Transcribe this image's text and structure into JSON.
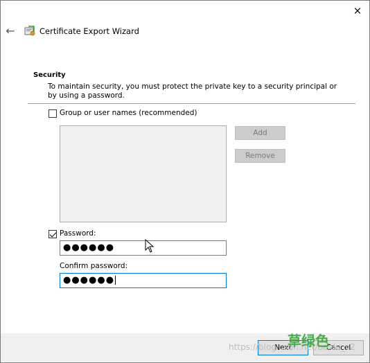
{
  "window": {
    "close_glyph": "✕",
    "back_glyph": "←",
    "title": "Certificate Export Wizard"
  },
  "security": {
    "title": "Security",
    "description": "To maintain security, you must protect the private key to a security principal or by using a password."
  },
  "group_option": {
    "label": "Group or user names (recommended)",
    "checked": false
  },
  "buttons": {
    "add": "Add",
    "remove": "Remove",
    "next": "Next",
    "cancel": "Cancel"
  },
  "password_option": {
    "label": "Password:",
    "checked": true,
    "value_masked": "●●●●●●"
  },
  "confirm_password": {
    "label": "Confirm password:",
    "value_masked": "●●●●●●"
  },
  "watermark": {
    "url": "https://blog.csdn.net/baidu_v2",
    "cn_text": "草绿色"
  }
}
